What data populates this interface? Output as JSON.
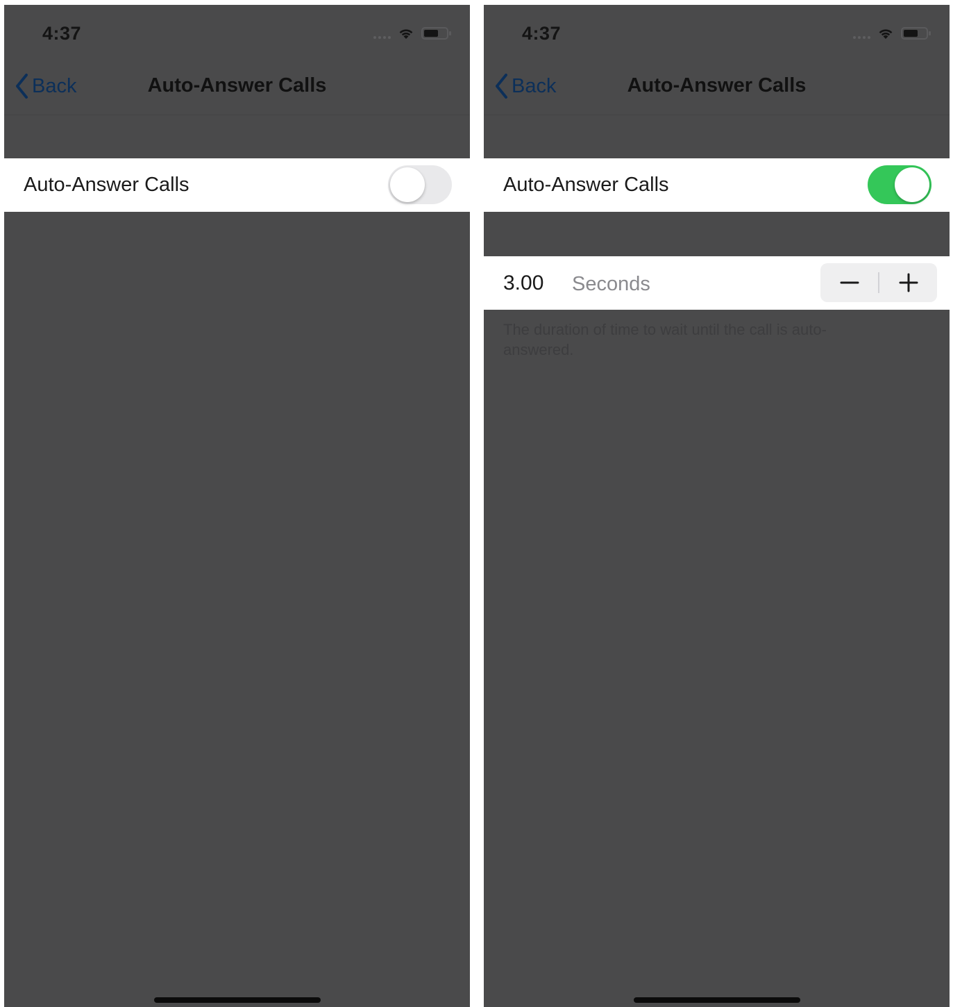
{
  "screens": [
    {
      "status_time": "4:37",
      "nav": {
        "back_label": "Back",
        "title": "Auto-Answer Calls"
      },
      "toggle_row": {
        "label": "Auto-Answer Calls",
        "state": "off"
      }
    },
    {
      "status_time": "4:37",
      "nav": {
        "back_label": "Back",
        "title": "Auto-Answer Calls"
      },
      "toggle_row": {
        "label": "Auto-Answer Calls",
        "state": "on"
      },
      "duration": {
        "value": "3.00",
        "unit": "Seconds"
      },
      "footer_note": "The duration of time to wait until the call is auto-answered."
    }
  ],
  "colors": {
    "background_dimmed": "#4a4a4b",
    "toggle_on": "#34c759",
    "toggle_off": "#e9e9eb",
    "back_link": "#0c2f59"
  },
  "icons": {
    "back": "chevron-left-icon",
    "signal": "cellular-signal-icon",
    "wifi": "wifi-icon",
    "battery": "battery-icon",
    "minus": "minus-icon",
    "plus": "plus-icon"
  }
}
